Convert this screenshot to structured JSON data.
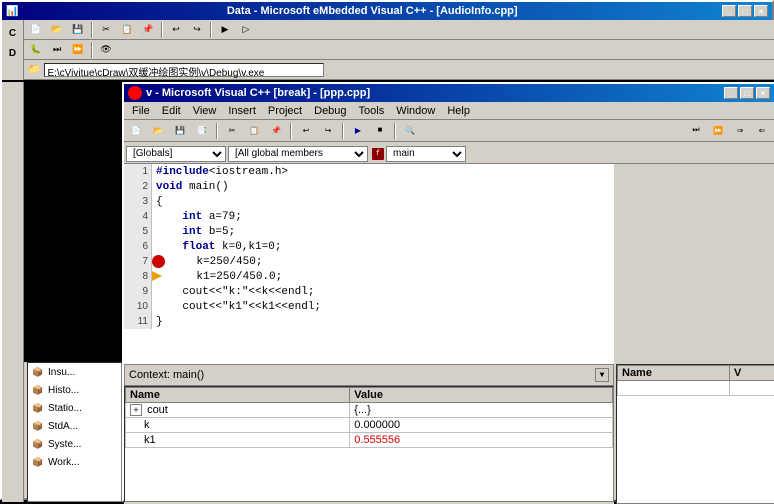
{
  "outer_window": {
    "title": "Data - Microsoft eMbedded Visual C++ - [AudioInfo.cpp]",
    "title_icon": "●"
  },
  "address_bar": {
    "path": "E:\\cVivitue\\cDraw\\双缓冲绘图实例\\v\\Debug\\v.exe"
  },
  "inner_window": {
    "title": "v - Microsoft Visual C++ [break] - [ppp.cpp]"
  },
  "menu": {
    "items": [
      "File",
      "Edit",
      "View",
      "Insert",
      "Project",
      "Debug",
      "Tools",
      "Window",
      "Help"
    ]
  },
  "dropdowns": {
    "scope": "[Globals]",
    "members": "[All global members",
    "function": "main"
  },
  "code": {
    "lines": [
      {
        "num": 1,
        "content": "#include<iostream.h>",
        "marker": ""
      },
      {
        "num": 2,
        "content": "void main()",
        "marker": ""
      },
      {
        "num": 3,
        "content": "{",
        "marker": ""
      },
      {
        "num": 4,
        "content": "    int a=79;",
        "marker": ""
      },
      {
        "num": 5,
        "content": "    int b=5;",
        "marker": ""
      },
      {
        "num": 6,
        "content": "    float k=0,k1=0;",
        "marker": ""
      },
      {
        "num": 7,
        "content": "    k=250/450;",
        "marker": "breakpoint"
      },
      {
        "num": 8,
        "content": "    k1=250/450.0;",
        "marker": "arrow"
      },
      {
        "num": 9,
        "content": "    cout<<\"k:\"<<k<<endl;",
        "marker": ""
      },
      {
        "num": 10,
        "content": "    cout<<\"k1\"<<k1<<endl;",
        "marker": ""
      },
      {
        "num": 11,
        "content": "}",
        "marker": ""
      }
    ]
  },
  "context_panel": {
    "title": "Context: main()"
  },
  "locals_table": {
    "headers": [
      "Name",
      "Value"
    ],
    "rows": [
      {
        "name": "cout",
        "value": "{...}",
        "expanded": false,
        "value_color": "black"
      },
      {
        "name": "k",
        "value": "0.000000",
        "expanded": false,
        "value_color": "black"
      },
      {
        "name": "k1",
        "value": "0.555556",
        "expanded": false,
        "value_color": "red"
      }
    ]
  },
  "watch_panel": {
    "title": "Name",
    "value_header": "V"
  },
  "left_panel_items": [
    {
      "label": "Insu..."
    },
    {
      "label": "Histo..."
    },
    {
      "label": "Statio..."
    },
    {
      "label": "StdA..."
    },
    {
      "label": "Syste..."
    },
    {
      "label": "Work..."
    }
  ],
  "buttons": {
    "minimize": "_",
    "maximize": "□",
    "close": "×"
  }
}
